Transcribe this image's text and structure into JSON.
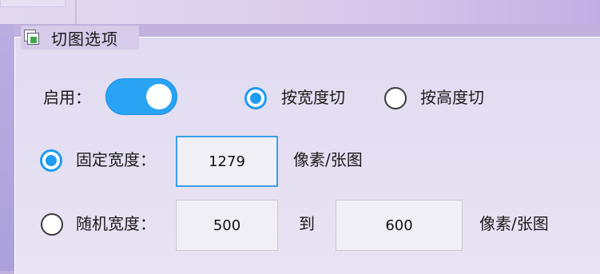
{
  "group": {
    "title": "切图选项"
  },
  "enable": {
    "label": "启用：",
    "on": true
  },
  "split_mode": {
    "options": [
      {
        "label": "按宽度切",
        "selected": true
      },
      {
        "label": "按高度切",
        "selected": false
      }
    ]
  },
  "fixed_width": {
    "label": "固定宽度：",
    "selected": true,
    "value": "1279",
    "unit": "像素/张图"
  },
  "random_width": {
    "label": "随机宽度：",
    "selected": false,
    "from": "500",
    "to_label": "到",
    "to": "600",
    "unit": "像素/张图"
  },
  "colors": {
    "accent": "#1e9cf0",
    "toggle": "#29a3f3"
  }
}
